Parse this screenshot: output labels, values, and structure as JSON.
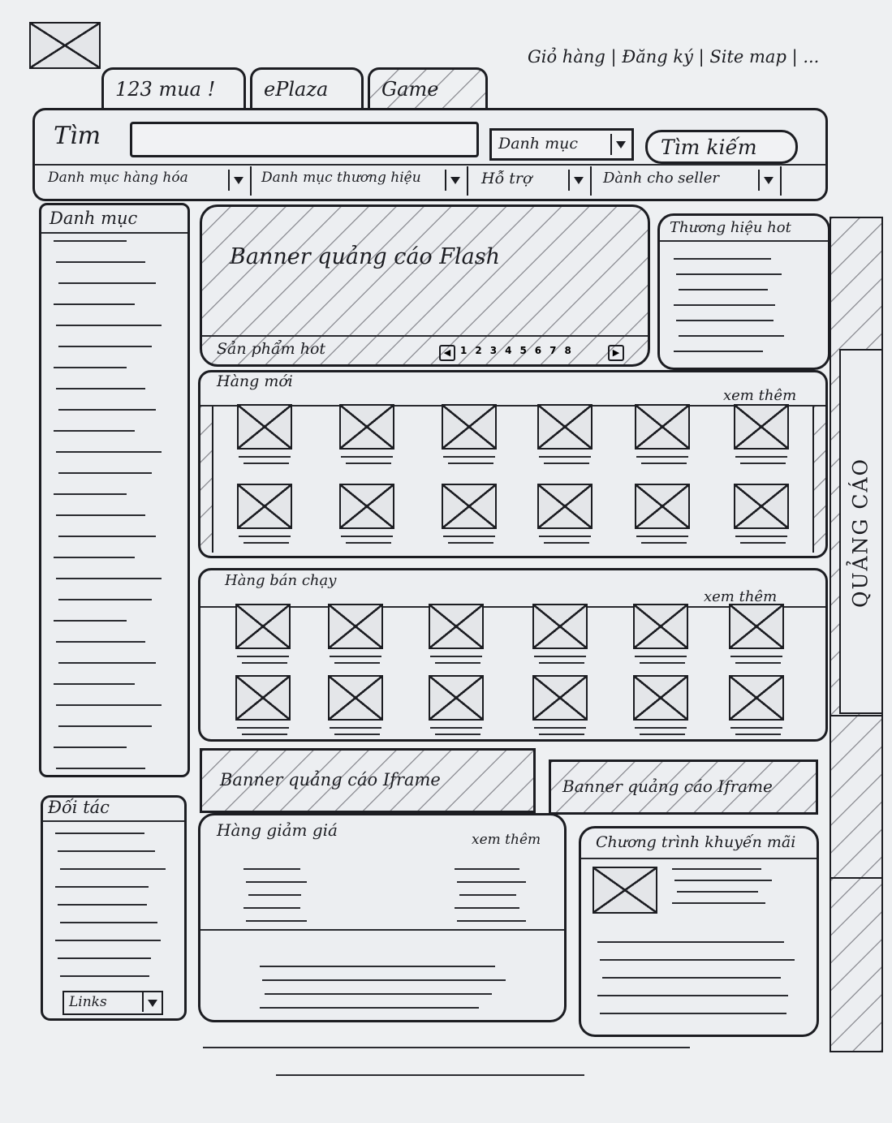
{
  "header": {
    "top_links": "Giỏ hàng | Đăng ký | Site map | ...",
    "logo_icon": "logo-placeholder-icon",
    "tabs": [
      "123 mua !",
      "ePlaza",
      "Game"
    ]
  },
  "search": {
    "label": "Tìm",
    "input_value": "",
    "category_select": "Danh mục",
    "button": "Tìm kiếm"
  },
  "nav": {
    "items": [
      "Danh mục hàng hóa",
      "Danh mục thương hiệu",
      "Hỗ trợ",
      "Dành cho seller"
    ]
  },
  "sidebar": {
    "categories_title": "Danh mục",
    "partners_title": "Đối tác",
    "links_select": "Links"
  },
  "banner": {
    "flash_text": "Banner quảng cáo Flash",
    "hot_label": "Sản phẩm hot",
    "pager": [
      "1",
      "2",
      "3",
      "4",
      "5",
      "6",
      "7",
      "8"
    ]
  },
  "hot_brands": {
    "title": "Thương hiệu hot"
  },
  "new_products": {
    "title": "Hàng mới",
    "more": "xem thêm"
  },
  "best_sellers": {
    "title": "Hàng bán chạy",
    "more": "xem thêm"
  },
  "iframe_banners": [
    "Banner quảng cáo Iframe",
    "Banner quảng cáo Iframe"
  ],
  "discount": {
    "title": "Hàng giảm giá",
    "more": "xem thêm"
  },
  "promo": {
    "title": "Chương trình khuyến mãi"
  },
  "ad_column": {
    "label": "QUẢNG CÁO"
  }
}
